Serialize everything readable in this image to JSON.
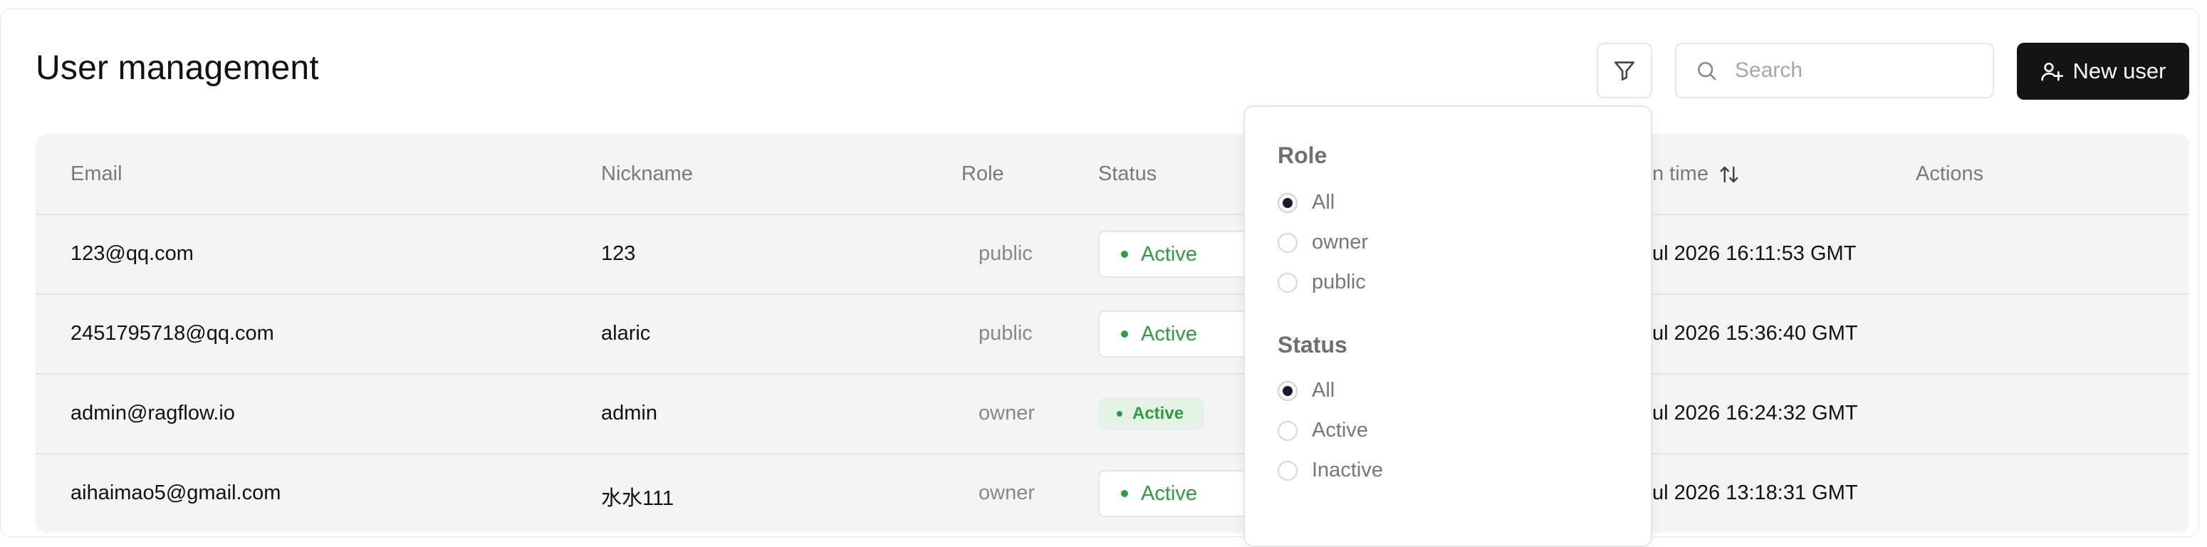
{
  "header": {
    "title": "User management",
    "search_placeholder": "Search",
    "new_user_label": "New user"
  },
  "table": {
    "columns": {
      "email": "Email",
      "nickname": "Nickname",
      "role": "Role",
      "status": "Status",
      "time": "n time",
      "actions": "Actions"
    },
    "rows": [
      {
        "email": "123@qq.com",
        "nickname": "123",
        "role": "public",
        "status": "Active",
        "time": "ul 2026 16:11:53 GMT"
      },
      {
        "email": "2451795718@qq.com",
        "nickname": "alaric",
        "role": "public",
        "status": "Active",
        "time": "ul 2026 15:36:40 GMT"
      },
      {
        "email": "admin@ragflow.io",
        "nickname": "admin",
        "role": "owner",
        "status": "Active",
        "time": "ul 2026 16:24:32 GMT"
      },
      {
        "email": "aihaimao5@gmail.com",
        "nickname": "水水111",
        "role": "owner",
        "status": "Active",
        "time": "ul 2026 13:18:31 GMT"
      }
    ]
  },
  "filter": {
    "role_title": "Role",
    "role_options": [
      "All",
      "owner",
      "public"
    ],
    "status_title": "Status",
    "status_options": [
      "All",
      "Active",
      "Inactive"
    ]
  },
  "colors": {
    "accent_dark": "#141414",
    "status_green": "#2e9b45",
    "table_bg": "#f4f4f4"
  },
  "icons": {
    "filter": "funnel-icon",
    "search": "search-icon",
    "new_user": "user-plus-icon",
    "sort": "sort-arrows-icon",
    "status": "dot-icon"
  }
}
